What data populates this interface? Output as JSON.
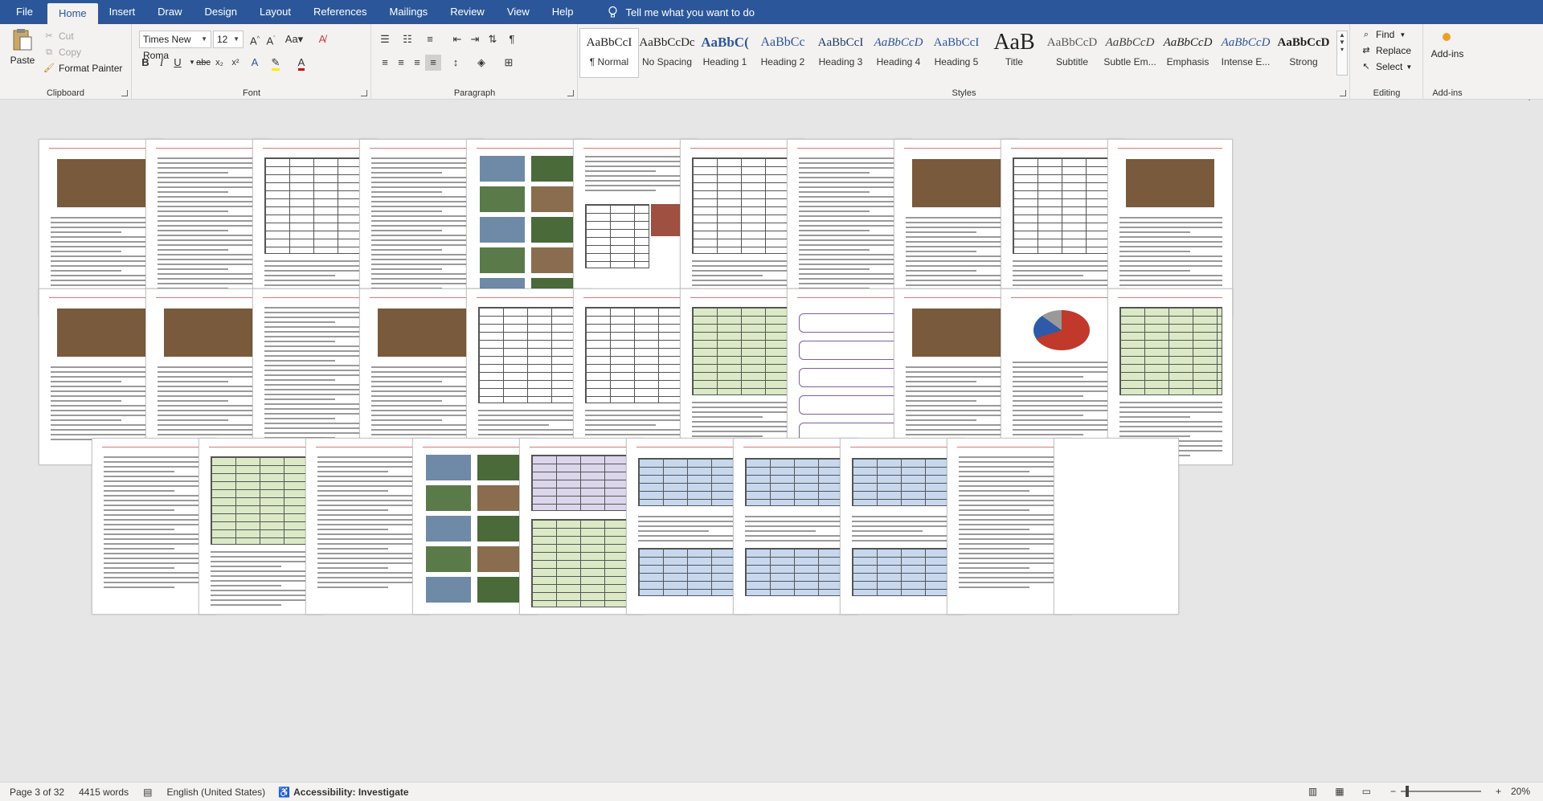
{
  "tabs": [
    "File",
    "Home",
    "Insert",
    "Draw",
    "Design",
    "Layout",
    "References",
    "Mailings",
    "Review",
    "View",
    "Help"
  ],
  "tell_me": "Tell me what you want to do",
  "ribbon": {
    "clipboard": {
      "paste": "Paste",
      "cut": "Cut",
      "copy": "Copy",
      "format_painter": "Format Painter",
      "label": "Clipboard"
    },
    "font": {
      "family": "Times New Roma",
      "size": "12",
      "label": "Font"
    },
    "paragraph": {
      "label": "Paragraph"
    },
    "styles": {
      "label": "Styles",
      "items": [
        {
          "sample": "AaBbCcI",
          "name": "¶ Normal"
        },
        {
          "sample": "AaBbCcDc",
          "name": "No Spacing"
        },
        {
          "sample": "AaBbC(",
          "name": "Heading 1"
        },
        {
          "sample": "AaBbCc",
          "name": "Heading 2"
        },
        {
          "sample": "AaBbCcI",
          "name": "Heading 3"
        },
        {
          "sample": "AaBbCcD",
          "name": "Heading 4"
        },
        {
          "sample": "AaBbCcI",
          "name": "Heading 5"
        },
        {
          "sample": "AaB",
          "name": "Title"
        },
        {
          "sample": "AaBbCcD",
          "name": "Subtitle"
        },
        {
          "sample": "AaBbCcD",
          "name": "Subtle Em..."
        },
        {
          "sample": "AaBbCcD",
          "name": "Emphasis"
        },
        {
          "sample": "AaBbCcD",
          "name": "Intense E..."
        },
        {
          "sample": "AaBbCcD",
          "name": "Strong"
        }
      ]
    },
    "editing": {
      "find": "Find",
      "replace": "Replace",
      "select": "Select",
      "label": "Editing"
    },
    "addins": {
      "button": "Add-ins",
      "label": "Add-ins"
    }
  },
  "status": {
    "page": "Page 3 of 32",
    "words": "4415 words",
    "language": "English (United States)",
    "accessibility": "Accessibility: Investigate",
    "focus": "Focus",
    "zoom": "20%"
  },
  "colors": {
    "ribbon_blue": "#2b579a",
    "canvas": "#e6e6e6"
  }
}
